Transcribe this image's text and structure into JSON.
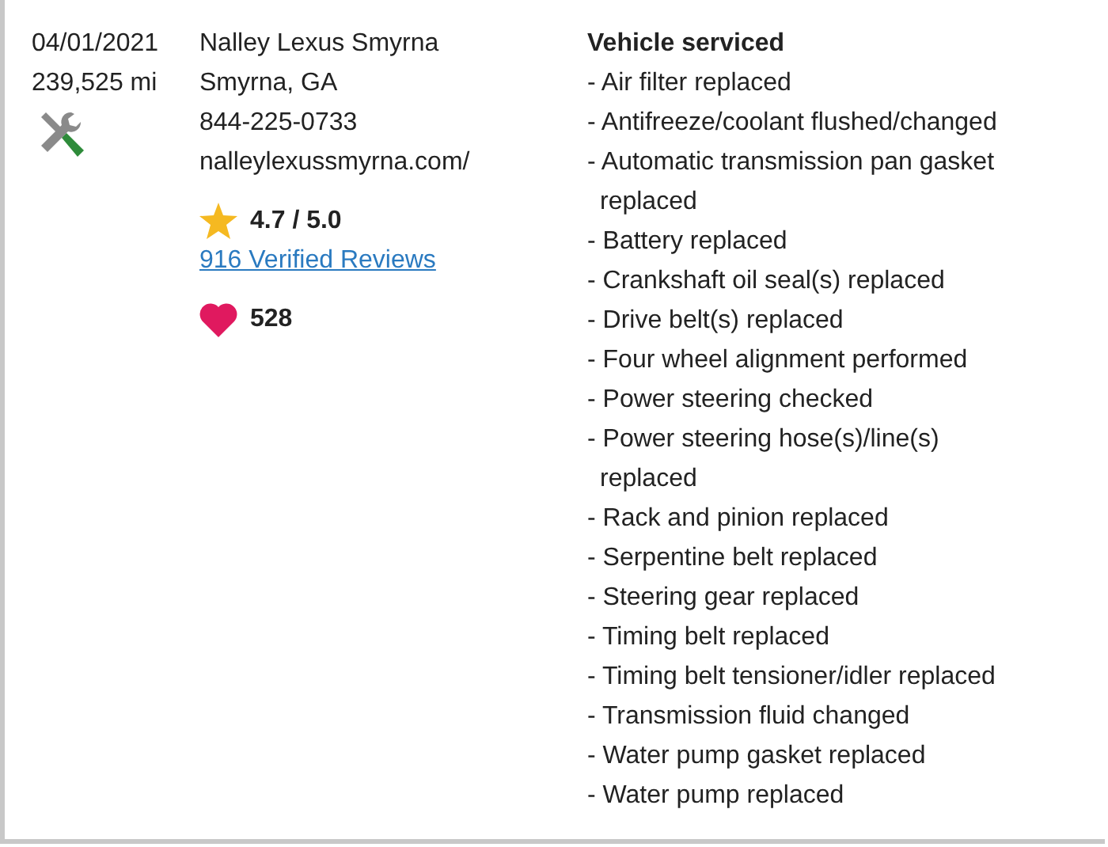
{
  "record": {
    "date": "04/01/2021",
    "mileage": "239,525 mi"
  },
  "shop": {
    "name": "Nalley Lexus Smyrna",
    "location": "Smyrna, GA",
    "phone": "844-225-0733",
    "website": "nalleylexussmyrna.com/",
    "rating": "4.7 / 5.0",
    "reviews_link": "916 Verified Reviews",
    "favorites": "528"
  },
  "services": {
    "heading": "Vehicle serviced",
    "items": [
      "- Air filter replaced",
      "- Antifreeze/coolant flushed/changed",
      "- Automatic transmission pan gasket replaced",
      "- Battery replaced",
      "- Crankshaft oil seal(s) replaced",
      "- Drive belt(s) replaced",
      "- Four wheel alignment performed",
      "- Power steering checked",
      "- Power steering hose(s)/line(s) replaced",
      "- Rack and pinion replaced",
      "- Serpentine belt replaced",
      "- Steering gear replaced",
      "- Timing belt replaced",
      "- Timing belt tensioner/idler replaced",
      "- Transmission fluid changed",
      "- Water pump gasket replaced",
      "- Water pump replaced"
    ]
  }
}
